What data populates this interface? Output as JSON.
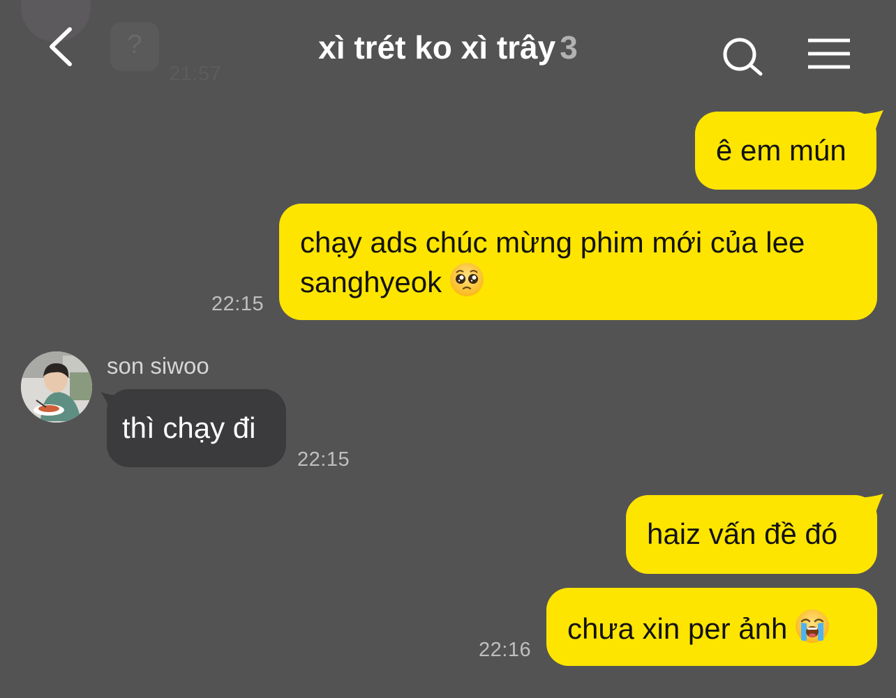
{
  "header": {
    "title": "xì trét ko xì trây",
    "member_count": "3",
    "back_icon": "chevron-left-icon",
    "search_icon": "search-icon",
    "menu_icon": "hamburger-menu-icon",
    "ghost_badge": "?",
    "ghost_time": "21:57"
  },
  "colors": {
    "background": "#545354",
    "my_bubble": "#fee500",
    "their_bubble": "#3b3a3c",
    "timestamp": "#c0bfc0"
  },
  "messages": [
    {
      "sender": "me",
      "text": "ê em mún"
    },
    {
      "sender": "me",
      "text": "chạy ads chúc mừng phim mới của lee",
      "text_line2": "sanghyeok",
      "emoji": "pleading-face-emoji",
      "time": "22:15"
    },
    {
      "sender": "son siwoo",
      "sender_name": "son siwoo",
      "avatar": "avatar",
      "text": "thì chạy đi",
      "time": "22:15"
    },
    {
      "sender": "me",
      "text": "haiz vấn đề đó"
    },
    {
      "sender": "me",
      "text": "chưa xin per ảnh",
      "emoji": "loudly-crying-face-emoji",
      "time": "22:16"
    }
  ]
}
